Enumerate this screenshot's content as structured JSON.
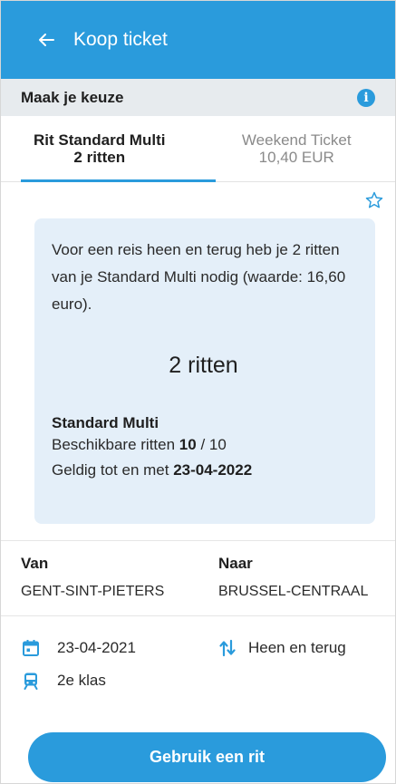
{
  "header": {
    "title": "Koop ticket"
  },
  "choice": {
    "label": "Maak je keuze"
  },
  "tabs": [
    {
      "line1": "Rit Standard Multi",
      "line2": "2 ritten",
      "active": true
    },
    {
      "line1": "Weekend Ticket",
      "line2": "10,40 EUR",
      "active": false
    }
  ],
  "card": {
    "description": "Voor een reis heen en terug heb je 2 ritten van je Standard Multi nodig (waarde: 16,60 euro).",
    "count": "2 ritten",
    "product": "Standard Multi",
    "available_prefix": "Beschikbare ritten ",
    "available_value": "10",
    "available_suffix": " / 10",
    "valid_prefix": "Geldig tot en met ",
    "valid_date": "23-04-2022"
  },
  "route": {
    "from_label": "Van",
    "from_value": "GENT-SINT-PIETERS",
    "to_label": "Naar",
    "to_value": "BRUSSEL-CENTRAAL"
  },
  "details": {
    "date": "23-04-2021",
    "trip_type": "Heen en terug",
    "class": "2e klas"
  },
  "actions": {
    "use_ride": "Gebruik een rit"
  },
  "icons": {
    "back": "arrow-left-icon",
    "info": "info-icon",
    "star": "star-outline-icon",
    "calendar": "calendar-icon",
    "round_trip": "round-trip-icon",
    "train": "train-icon"
  },
  "colors": {
    "primary": "#2a9bdc",
    "card_bg": "#e4eff9",
    "choice_bg": "#e7ebee"
  }
}
